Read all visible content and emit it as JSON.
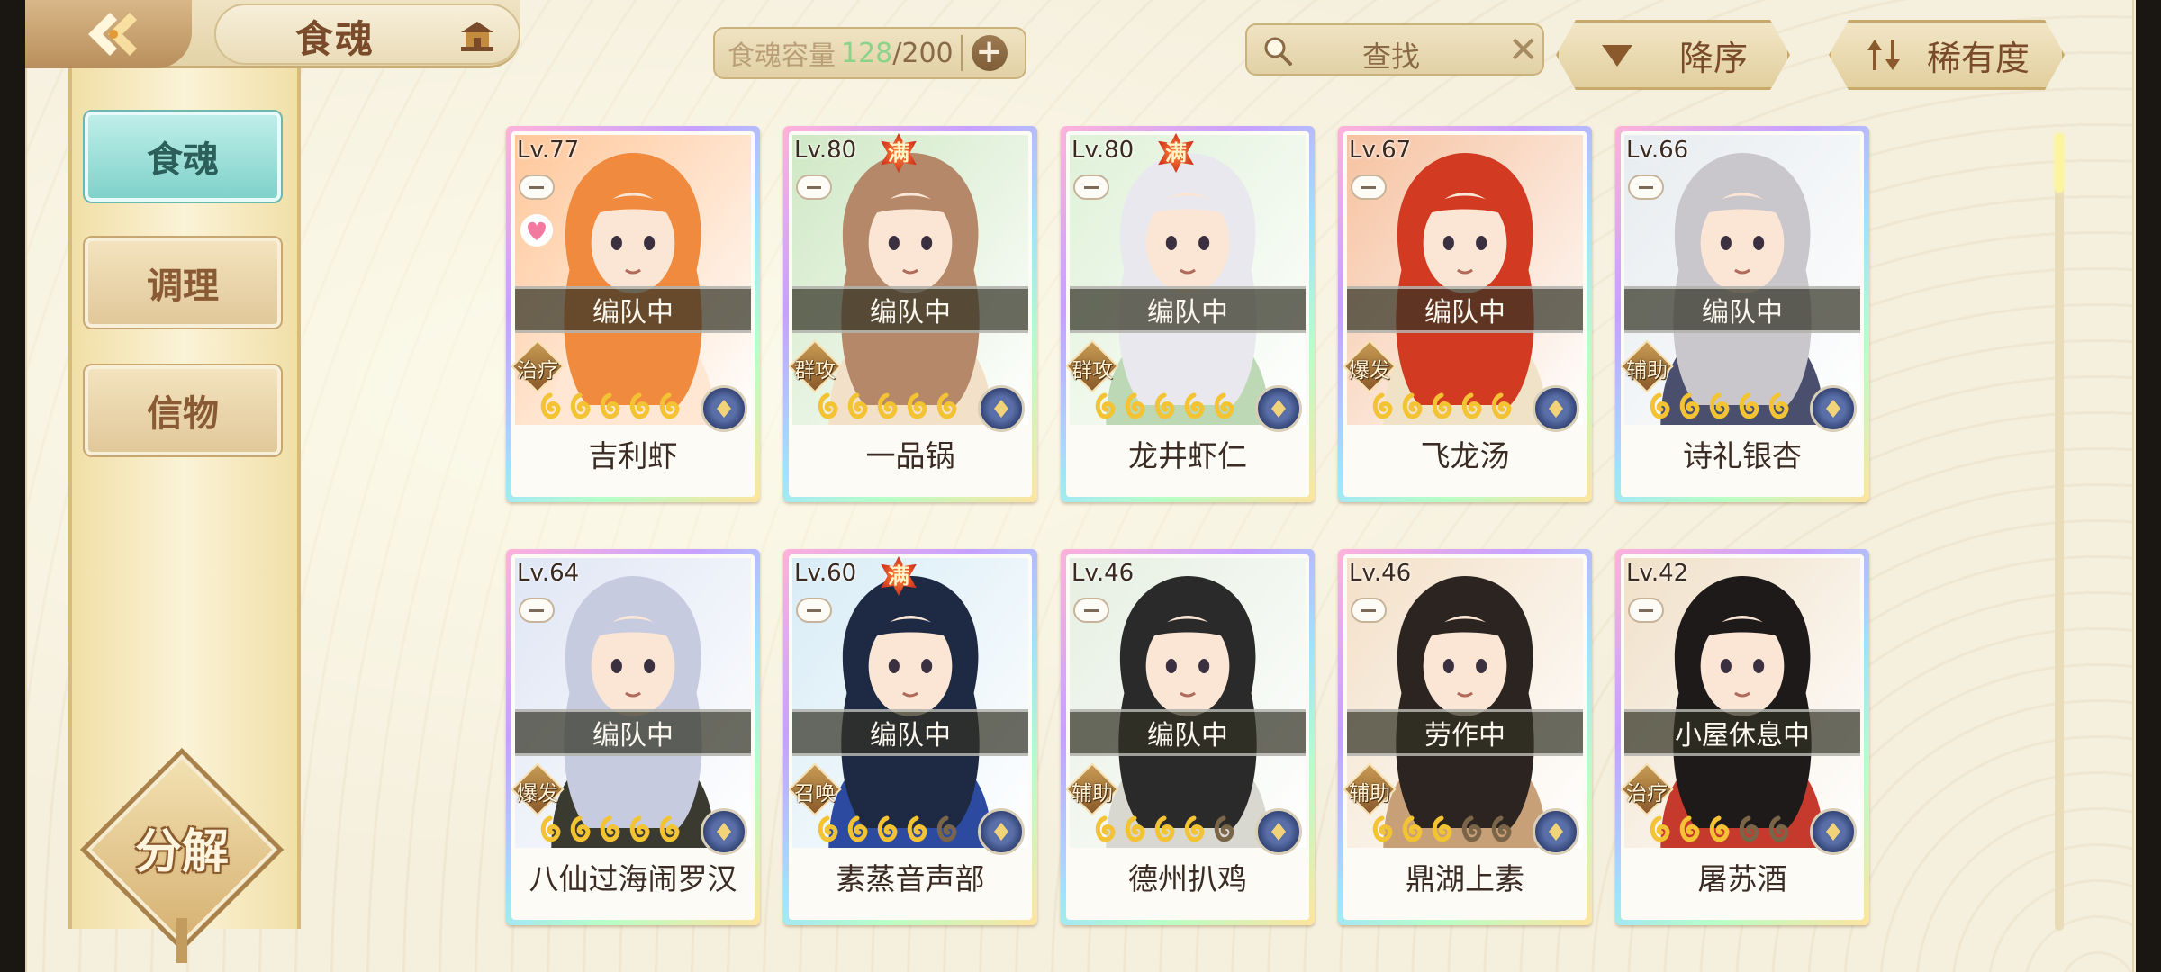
{
  "header": {
    "title": "食魂",
    "capacity_label": "食魂容量",
    "capacity_current": "128",
    "capacity_max": "/200",
    "capacity_add": "+",
    "search_placeholder": "查找",
    "search_clear": "✕",
    "sort_order": "降序",
    "sort_key": "稀有度"
  },
  "sidebar": {
    "tabs": [
      {
        "label": "食魂",
        "active": true
      },
      {
        "label": "调理",
        "active": false
      },
      {
        "label": "信物",
        "active": false
      }
    ],
    "decompose_label": "分解"
  },
  "colors": {
    "accent_teal": "#7fd2ca",
    "capacity_green": "#8cd38a",
    "status_band": "#323224",
    "brown_text": "#7a4b2a"
  },
  "cards": [
    {
      "level": "Lv.77",
      "full": false,
      "status": "编队中",
      "role": "治疗",
      "stars": 5,
      "name": "吉利虾",
      "palette": [
        "#ffc79a",
        "#f08a3e",
        "#ffe7d3"
      ],
      "favorite": true
    },
    {
      "level": "Lv.80",
      "full": true,
      "status": "编队中",
      "role": "群攻",
      "stars": 5,
      "name": "一品锅",
      "palette": [
        "#cfe8c4",
        "#b48868",
        "#f2e1c8"
      ],
      "favorite": false
    },
    {
      "level": "Lv.80",
      "full": true,
      "status": "编队中",
      "role": "群攻",
      "stars": 5,
      "name": "龙井虾仁",
      "palette": [
        "#dff1d8",
        "#e8e8ee",
        "#bcd8b4"
      ],
      "favorite": false
    },
    {
      "level": "Lv.67",
      "full": false,
      "status": "编队中",
      "role": "爆发",
      "stars": 5,
      "name": "飞龙汤",
      "palette": [
        "#f6c2a0",
        "#d23a22",
        "#f0e2c6"
      ],
      "favorite": false
    },
    {
      "level": "Lv.66",
      "full": false,
      "status": "编队中",
      "role": "辅助",
      "stars": 5,
      "name": "诗礼银杏",
      "palette": [
        "#e7ecf0",
        "#c9c6cc",
        "#4a4f6e"
      ],
      "favorite": false
    },
    {
      "level": "Lv.64",
      "full": false,
      "status": "编队中",
      "role": "爆发",
      "stars": 5,
      "name": "八仙过海闹罗汉",
      "palette": [
        "#dfe6f4",
        "#c7cbe0",
        "#3a3a30"
      ],
      "favorite": false
    },
    {
      "level": "Lv.60",
      "full": true,
      "status": "编队中",
      "role": "召唤",
      "stars": 4,
      "name": "素蒸音声部",
      "palette": [
        "#d8ecf6",
        "#1e2a44",
        "#2c4aa0"
      ],
      "favorite": false
    },
    {
      "level": "Lv.46",
      "full": false,
      "status": "编队中",
      "role": "辅助",
      "stars": 4,
      "name": "德州扒鸡",
      "palette": [
        "#e6efe2",
        "#2a2a2a",
        "#d8d8d0"
      ],
      "favorite": false
    },
    {
      "level": "Lv.46",
      "full": false,
      "status": "劳作中",
      "role": "辅助",
      "stars": 3,
      "name": "鼎湖上素",
      "palette": [
        "#f3e0c8",
        "#2b2420",
        "#c8a078"
      ],
      "favorite": false
    },
    {
      "level": "Lv.42",
      "full": false,
      "status": "小屋休息中",
      "role": "治疗",
      "stars": 3,
      "name": "屠苏酒",
      "palette": [
        "#f0e0c8",
        "#1e1a1a",
        "#c63a2e"
      ],
      "favorite": false
    }
  ]
}
